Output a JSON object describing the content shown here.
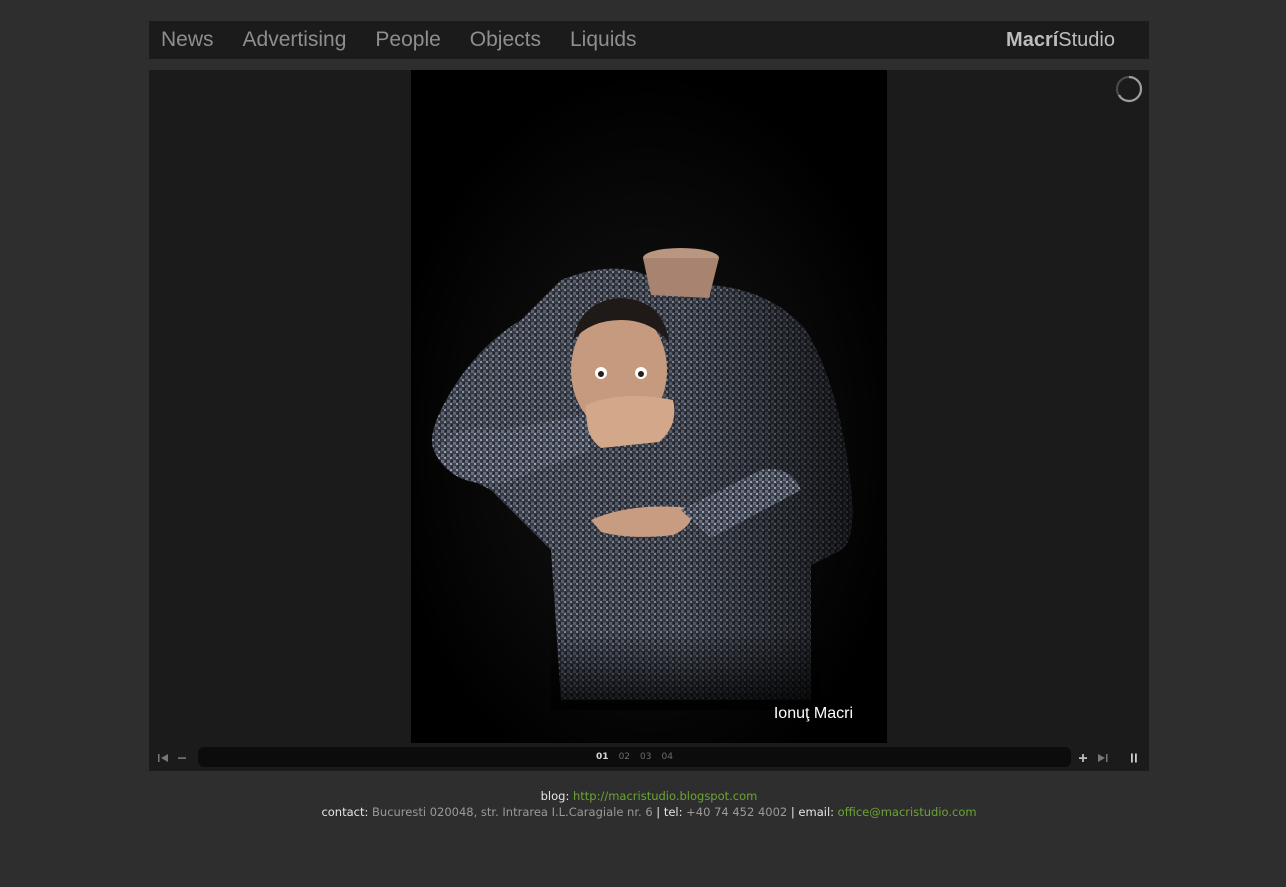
{
  "nav": {
    "items": [
      "News",
      "Advertising",
      "People",
      "Objects",
      "Liquids"
    ]
  },
  "logo": {
    "bold": "Macrí",
    "regular": "Studio"
  },
  "photo": {
    "caption": "Ionuţ Macri"
  },
  "controls": {
    "pages": [
      "01",
      "02",
      "03",
      "04"
    ],
    "active_page": "01",
    "icons": {
      "first": "skip-first-icon",
      "minus": "minus-icon",
      "plus": "plus-icon",
      "last": "skip-last-icon",
      "pause": "pause-icon"
    }
  },
  "footer": {
    "blog_label": "blog:",
    "blog_url": "http://macristudio.blogspot.com",
    "contact_label": "contact:",
    "address": "Bucuresti 020048, str. Intrarea I.L.Caragiale nr. 6",
    "sep1": "|",
    "tel_label": "tel:",
    "tel": "+40 74 452 4002",
    "sep2": "|",
    "email_label": "email:",
    "email": "office@macristudio.com"
  },
  "colors": {
    "page_bg": "#2e2e2e",
    "panel_bg": "#1b1b1b",
    "link_green": "#6aa535"
  }
}
